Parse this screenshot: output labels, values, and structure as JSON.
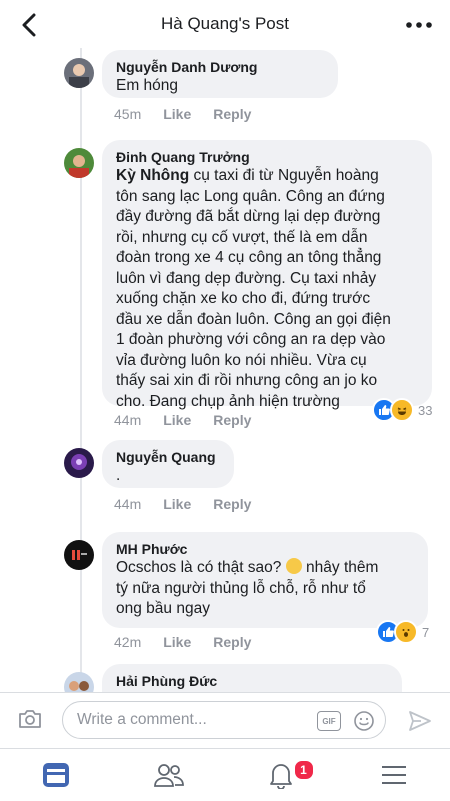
{
  "header": {
    "title": "Hà Quang's Post"
  },
  "comments": [
    {
      "author": "Nguyễn Danh Dương",
      "text": "Em hóng",
      "time": "45m",
      "like": "Like",
      "reply": "Reply"
    },
    {
      "author": "Đinh Quang Trưởng",
      "tag": "Kỳ Nhông",
      "lines": [
        " cụ taxi đi từ Nguyễn hoàng",
        "tôn sang lạc Long quân. Công an đứng",
        "đầy đường đã bắt dừng lại dẹp đường",
        "rồi, nhưng cụ cố vượt, thế là em dẫn",
        "đoàn trong xe 4 cụ công an tông thẳng",
        "luôn vì đang dẹp đường. Cụ taxi nhảy",
        "xuống chặn xe ko cho đi, đứng trước",
        "đầu xe dẫn đoàn luôn. Công an gọi điện",
        "1 đoàn phường với công an ra dẹp vào",
        "vỉa đường luôn ko nói nhiều. Vừa cụ",
        "thấy sai xin đi rồi nhưng công an jo ko",
        "cho. Đang chụp ảnh hiện trường"
      ],
      "time": "44m",
      "like": "Like",
      "reply": "Reply",
      "reaction_count": "33"
    },
    {
      "author": "Nguyễn Quang",
      "text": ".",
      "time": "44m",
      "like": "Like",
      "reply": "Reply"
    },
    {
      "author": "MH Phước",
      "lines": [
        "Ocschos là có thật sao? ",
        " nhây thêm",
        "tý nữa người thủng lỗ chỗ, rỗ như tổ",
        "ong bầu ngay"
      ],
      "time": "42m",
      "like": "Like",
      "reply": "Reply",
      "reaction_count": "7"
    },
    {
      "author": "Hải Phùng Đức"
    }
  ],
  "composer": {
    "placeholder": "Write a comment...",
    "gif_label": "GIF"
  },
  "tabs": {
    "notifications_badge": "1"
  },
  "colors": {
    "accent": "#4267b2",
    "like_blue": "#1877f2",
    "badge_red": "#f02849"
  }
}
